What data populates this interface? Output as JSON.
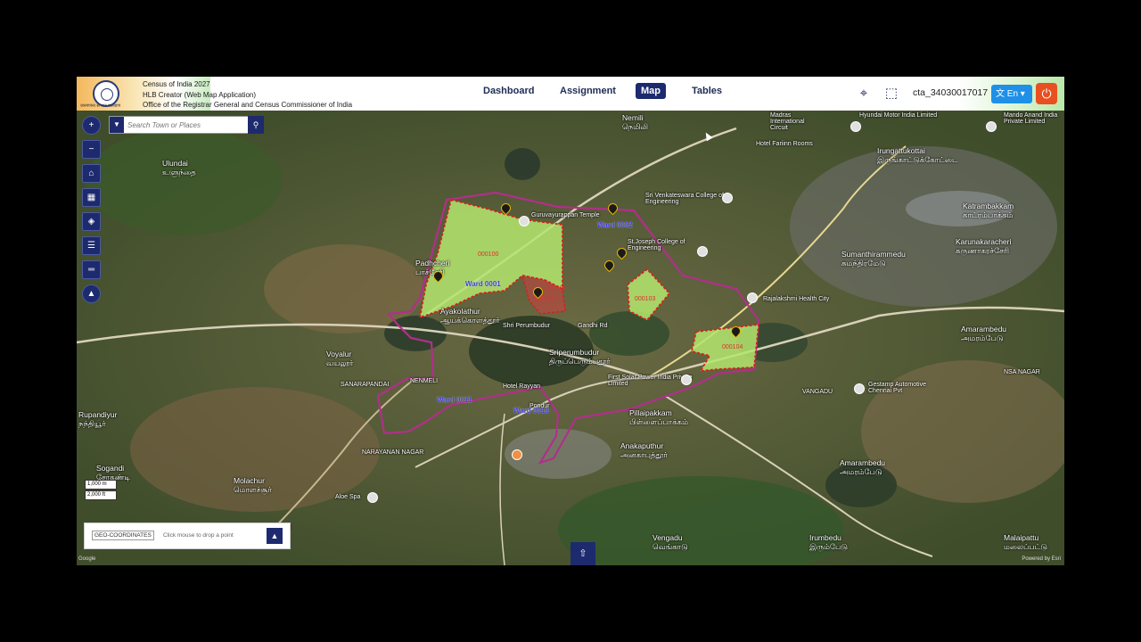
{
  "header": {
    "titles": [
      "Census of India 2027",
      "HLB Creator  (Web Map Application)",
      "Office of the Registrar General and Census Commissioner of India"
    ],
    "emblem_caption": "जनगणना से जन कल्याण",
    "nav": [
      "Dashboard",
      "Assignment",
      "Map",
      "Tables"
    ],
    "active_nav": "Map",
    "user_id": "cta_34030017017",
    "language": "En",
    "icons": [
      "location-add-icon",
      "polygon-select-icon",
      "translate-icon",
      "power-icon"
    ]
  },
  "map": {
    "search_placeholder": "Search Town or Places",
    "place_labels": [
      {
        "name": "Ulundai",
        "tamil": "உளுந்தை"
      },
      {
        "name": "Voyalur",
        "tamil": "வயலூர்"
      },
      {
        "name": "Sriperumbudur",
        "tamil": "திருப்பெரும்புதூர்"
      },
      {
        "name": "Pillaipakkam",
        "tamil": "பிள்ளைப்பாக்கம்"
      },
      {
        "name": "Anakaputhur",
        "tamil": "அனகாபுத்தூர்"
      },
      {
        "name": "Molachur",
        "tamil": "மொளச்சூர்"
      },
      {
        "name": "Sogandi",
        "tamil": "சோகண்டி"
      },
      {
        "name": "Amarambedu",
        "tamil": "அமரம்பேடு"
      },
      {
        "name": "Vengadu",
        "tamil": "வெங்காடு"
      },
      {
        "name": "Irumbedu",
        "tamil": "இரும்பேடு"
      },
      {
        "name": "Malaipattu",
        "tamil": "மலைப்பட்டு"
      },
      {
        "name": "Katrambakkam",
        "tamil": "காட்ரம்பாக்கம்"
      },
      {
        "name": "Karunakaracheri",
        "tamil": "கருணாகரச்சேரி"
      },
      {
        "name": "Sumanthirammedu",
        "tamil": "சுமந்திரமேடு"
      },
      {
        "name": "Irungattukottai",
        "tamil": "இருங்காட்டுக்கோட்டை"
      },
      {
        "name": "Nemili",
        "tamil": "நெமிலி"
      },
      {
        "name": "Ayakolathur",
        "tamil": "ஆயக்கொளத்தூர்"
      },
      {
        "name": "Padhcheri",
        "tamil": "பாச்சேரி"
      },
      {
        "name": "Rupandiyur",
        "tamil": "நந்தியூர்"
      }
    ],
    "small_labels": [
      "NENMELI",
      "SANARAPANDAI",
      "NARAYANAN NAGAR",
      "VANGADU",
      "NSA NAGAR",
      "Pondur",
      "Hotel Rayyan",
      "Shri Perumbudur",
      "Gandhi Rd",
      "Aloe Spa"
    ],
    "poi_labels": [
      "Guruvayurappan Temple",
      "Sri Venkateswara College of Engineering",
      "St.Joseph College of Engineering",
      "Rajalakshmi Health City",
      "Hotel Fariinn Rooms",
      "Hyundai Motor India Limited",
      "First Solar Power India Private Limited",
      "Gestamp Automotive Chennai Pvt",
      "Fairfield by Marriott Sriperumbudur",
      "Madras International Circuit",
      "Mando Anand India Private Limited"
    ],
    "wards": [
      "Ward 0001",
      "Ward 0002",
      "Ward 0011",
      "Ward 0018"
    ],
    "block_codes": [
      "000100",
      "000101",
      "000102",
      "000103",
      "000104"
    ],
    "scale": [
      "1,000 m",
      "2,000 ft"
    ],
    "geo_label": "GEO-COORDINATES",
    "geo_hint": "Click mouse to drop a point",
    "attribution_left": "Google",
    "attribution_right": "Powered by Esri"
  },
  "colors": {
    "nav_active": "#1e2a6e",
    "polygon_fill": "#b4e66e",
    "polygon_border": "#d42020",
    "ward_boundary": "#a0287a"
  }
}
